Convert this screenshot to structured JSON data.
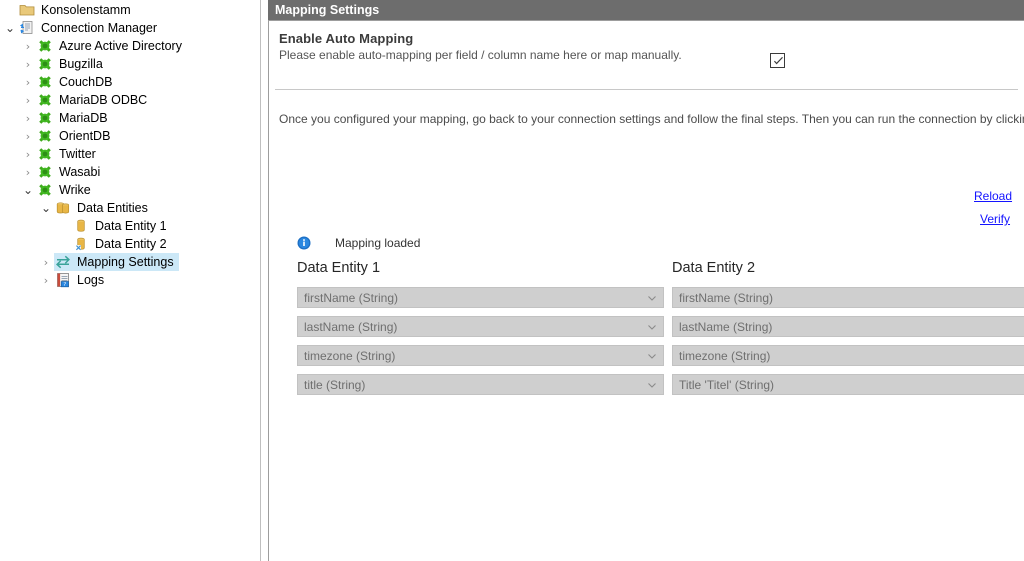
{
  "tree": {
    "root_label": "Konsolenstamm",
    "items": [
      {
        "label": "Konsolenstamm",
        "level": 0,
        "icon": "folder-icon",
        "twisty": "none",
        "selected": false
      },
      {
        "label": "Connection Manager",
        "level": 1,
        "icon": "connection-manager-icon",
        "twisty": "expanded",
        "selected": false
      },
      {
        "label": "Azure Active Directory",
        "level": 2,
        "icon": "plug-icon",
        "twisty": "collapsed",
        "selected": false
      },
      {
        "label": "Bugzilla",
        "level": 2,
        "icon": "plug-icon",
        "twisty": "collapsed",
        "selected": false
      },
      {
        "label": "CouchDB",
        "level": 2,
        "icon": "plug-icon",
        "twisty": "collapsed",
        "selected": false
      },
      {
        "label": "MariaDB ODBC",
        "level": 2,
        "icon": "plug-icon",
        "twisty": "collapsed",
        "selected": false
      },
      {
        "label": "MariaDB",
        "level": 2,
        "icon": "plug-icon",
        "twisty": "collapsed",
        "selected": false
      },
      {
        "label": "OrientDB",
        "level": 2,
        "icon": "plug-icon",
        "twisty": "collapsed",
        "selected": false
      },
      {
        "label": "Twitter",
        "level": 2,
        "icon": "plug-icon",
        "twisty": "collapsed",
        "selected": false
      },
      {
        "label": "Wasabi",
        "level": 2,
        "icon": "plug-icon",
        "twisty": "collapsed",
        "selected": false
      },
      {
        "label": "Wrike",
        "level": 2,
        "icon": "plug-icon",
        "twisty": "expanded",
        "selected": false
      },
      {
        "label": "Data Entities",
        "level": 3,
        "icon": "data-entities-icon",
        "twisty": "expanded",
        "selected": false
      },
      {
        "label": "Data Entity 1",
        "level": 4,
        "icon": "data-entity-icon",
        "twisty": "none",
        "selected": false
      },
      {
        "label": "Data Entity 2",
        "level": 4,
        "icon": "data-entity-alt-icon",
        "twisty": "none",
        "selected": false
      },
      {
        "label": "Mapping Settings",
        "level": 3,
        "icon": "mapping-settings-icon",
        "twisty": "collapsed",
        "selected": true
      },
      {
        "label": "Logs",
        "level": 3,
        "icon": "logs-icon",
        "twisty": "collapsed",
        "selected": false
      }
    ]
  },
  "panel": {
    "header_title": "Mapping Settings",
    "auto_mapping": {
      "title": "Enable Auto Mapping",
      "description": "Please enable auto-mapping per field / column name here or map manually.",
      "checked": true
    },
    "intro_text": "Once you configured your mapping, go back to your connection settings and follow the final steps. Then you can run the connection by clicking 'Run now'",
    "links": [
      {
        "label": "Reload",
        "name": "reload-link"
      },
      {
        "label": "Verify",
        "name": "verify-link"
      }
    ],
    "status": {
      "icon": "info-icon",
      "text": "Mapping loaded"
    },
    "columns": [
      {
        "title": "Data Entity 1",
        "fields": [
          "firstName (String)",
          "lastName (String)",
          "timezone (String)",
          "title (String)"
        ]
      },
      {
        "title": "Data Entity 2",
        "fields": [
          "firstName (String)",
          "lastName (String)",
          "timezone (String)",
          "Title 'Titel' (String)"
        ]
      }
    ]
  },
  "colors": {
    "header_bar": "#6d6d6d",
    "selection": "#cce8f7",
    "link": "#1414ff",
    "combo_bg": "#cfcfcf",
    "plug_green": "#3faa1e",
    "entity_yellow": "#e8b646"
  }
}
